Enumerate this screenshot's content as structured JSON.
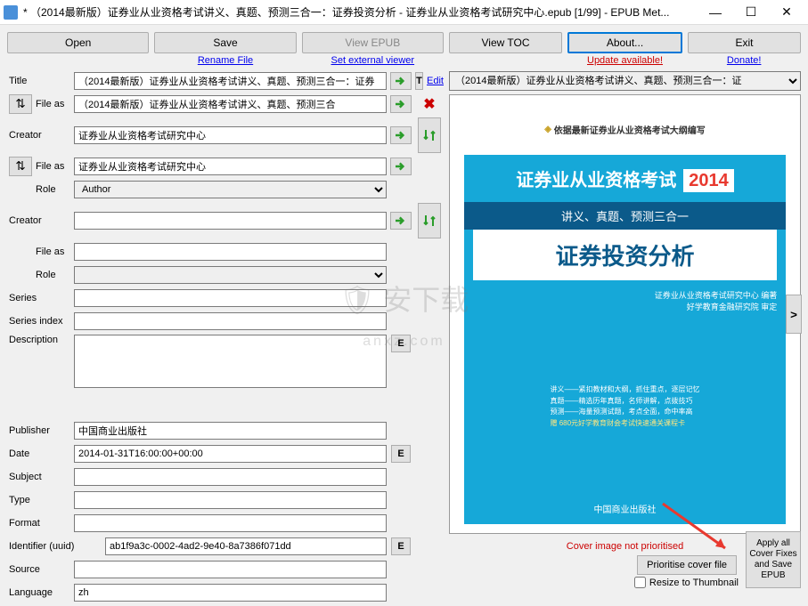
{
  "window": {
    "title": "* （2014最新版）证券业从业资格考试讲义、真题、预测三合一：证券投资分析 - 证券业从业资格考试研究中心.epub [1/99] - EPUB Met..."
  },
  "toolbar": {
    "open": "Open",
    "save": "Save",
    "view_epub": "View EPUB",
    "view_toc": "View TOC",
    "about": "About...",
    "exit": "Exit"
  },
  "links": {
    "rename_file": "Rename File",
    "set_external_viewer": "Set external viewer",
    "update_available": "Update available!",
    "donate": "Donate!"
  },
  "edit": {
    "t": "T",
    "edit": "Edit",
    "e": "E"
  },
  "labels": {
    "title": "Title",
    "file_as": "File as",
    "creator": "Creator",
    "role": "Role",
    "series": "Series",
    "series_index": "Series index",
    "description": "Description",
    "publisher": "Publisher",
    "date": "Date",
    "subject": "Subject",
    "type": "Type",
    "format": "Format",
    "identifier": "Identifier (uuid)",
    "source": "Source",
    "language": "Language"
  },
  "fields": {
    "title": "（2014最新版）证券业从业资格考试讲义、真题、预测三合一：证券",
    "title_fileas": "（2014最新版）证券业从业资格考试讲义、真题、预测三合",
    "creator1": "证券业从业资格考试研究中心",
    "creator1_fileas": "证券业从业资格考试研究中心",
    "role1": "Author",
    "creator2": "",
    "creator2_fileas": "",
    "role2": "",
    "series": "",
    "series_index": "",
    "description": "",
    "publisher": "中国商业出版社",
    "date": "2014-01-31T16:00:00+00:00",
    "subject": "",
    "type": "",
    "format": "",
    "identifier": "ab1f9a3c-0002-4ad2-9e40-8a7386f071dd",
    "source": "",
    "language": "zh"
  },
  "right": {
    "title_dropdown": "（2014最新版）证券业从业资格考试讲义、真题、预测三合一：证",
    "cover_status": "Cover image not prioritised",
    "prioritise": "Prioritise cover file",
    "apply": "Apply all Cover Fixes and Save EPUB",
    "resize": "Resize to Thumbnail"
  },
  "cover": {
    "top_line": "依据最新证券业从业资格考试大纲编写",
    "line1a": "证券业从业资格考试",
    "line1b": "2014",
    "line2": "讲义、真题、预测三合一",
    "line3": "证券投资分析",
    "credit1": "证券业从业资格考试研究中心  编著",
    "credit2": "好学教育金融研究院  审定",
    "bullet1": "讲义——紧扣教材和大纲，抓住重点，逐层记忆",
    "bullet2": "真题——精选历年真题，名师讲解，点拨技巧",
    "bullet3": "预测——海量预测试题，考点全面，命中率高",
    "bonus": "赠 680元好学教育财会考试快速通关课程卡",
    "publisher": "中国商业出版社"
  }
}
